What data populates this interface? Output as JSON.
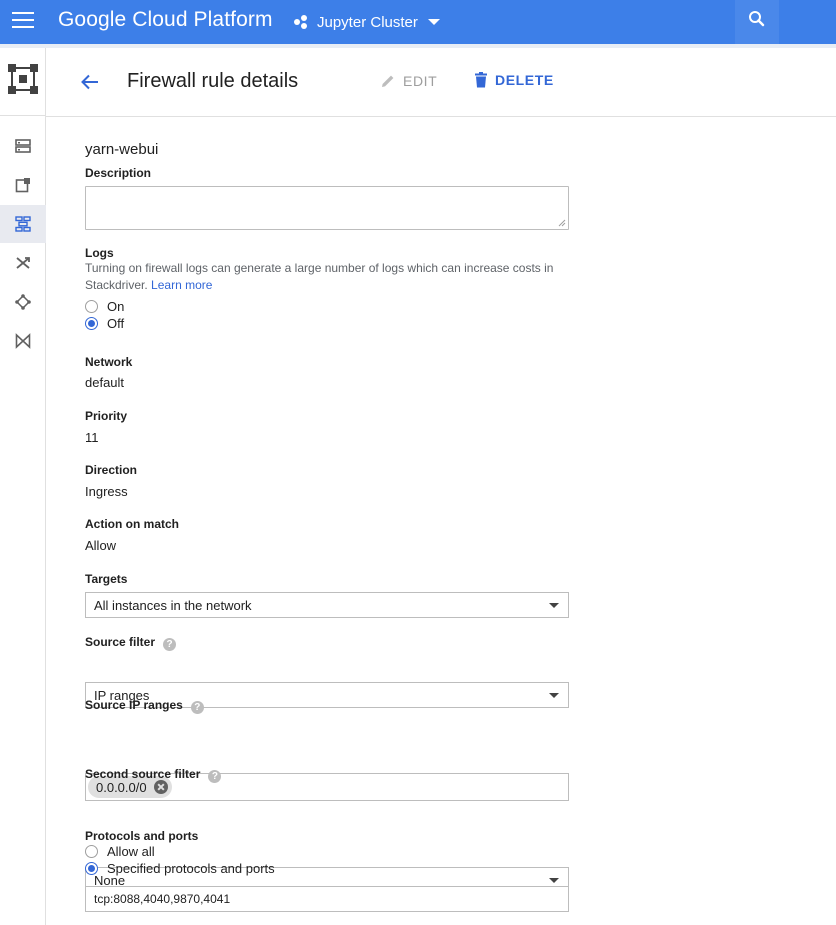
{
  "topbar": {
    "brand": "Google Cloud Platform",
    "project": "Jupyter Cluster",
    "accent_color": "#3d7fe8"
  },
  "rail": {
    "items": [
      {
        "icon": "server-icon"
      },
      {
        "icon": "external-ip-icon"
      },
      {
        "icon": "firewall-icon",
        "active": true
      },
      {
        "icon": "routes-icon"
      },
      {
        "icon": "peering-icon"
      },
      {
        "icon": "shared-vpc-icon"
      }
    ]
  },
  "header": {
    "title": "Firewall rule details",
    "edit_label": "EDIT",
    "delete_label": "DELETE"
  },
  "rule": {
    "name": "yarn-webui",
    "description_label": "Description",
    "description_value": "",
    "logs_label": "Logs",
    "logs_help": "Turning on firewall logs can generate a large number of logs which can increase costs in Stackdriver.",
    "logs_learn_more": "Learn more",
    "logs_on": "On",
    "logs_off": "Off",
    "logs_selected": "Off",
    "network_label": "Network",
    "network_value": "default",
    "priority_label": "Priority",
    "priority_value": "11",
    "direction_label": "Direction",
    "direction_value": "Ingress",
    "action_label": "Action on match",
    "action_value": "Allow",
    "targets_label": "Targets",
    "targets_value": "All instances in the network",
    "source_filter_label": "Source filter",
    "source_filter_value": "IP ranges",
    "source_ip_label": "Source IP ranges",
    "source_ip_chip": "0.0.0.0/0",
    "second_source_label": "Second source filter",
    "second_source_value": "None",
    "protocols_label": "Protocols and ports",
    "protocols_allow_all": "Allow all",
    "protocols_specified": "Specified protocols and ports",
    "protocols_selected": "Specified protocols and ports",
    "protocols_value": "tcp:8088,4040,9870,4041"
  }
}
